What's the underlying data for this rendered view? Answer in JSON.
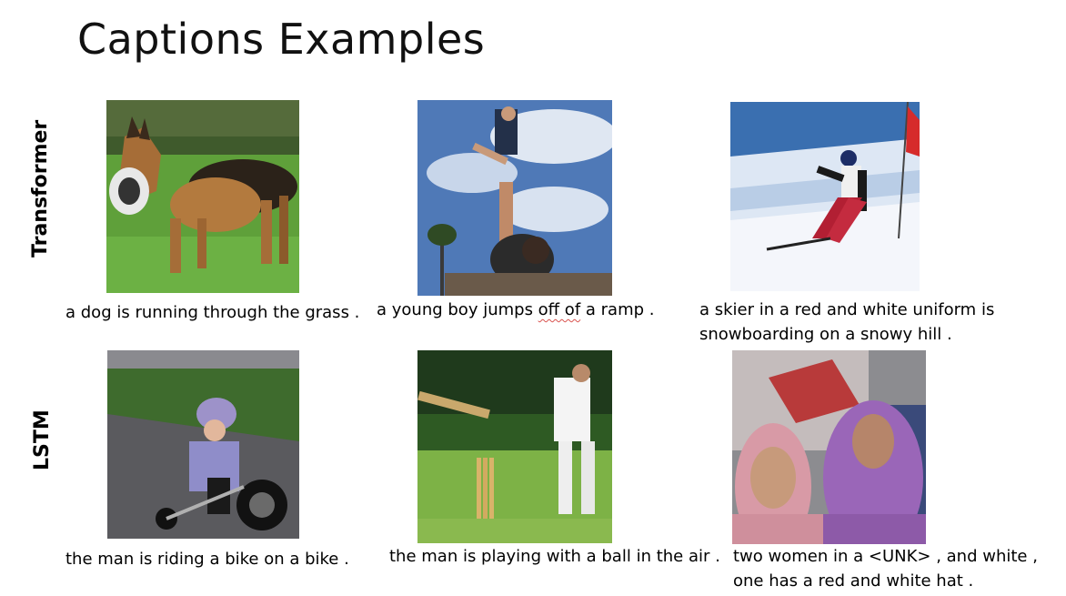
{
  "slide": {
    "title": "Captions Examples"
  },
  "rows": {
    "transformer_label": "Transformer",
    "lstm_label": "LSTM"
  },
  "captions": {
    "t1": "a dog is running through the grass .",
    "t2_pre": "a young boy jumps ",
    "t2_mark": "off of",
    "t2_post": " a ramp .",
    "t3_line1": "a skier in a red and white uniform is",
    "t3_line2": "snowboarding on a snowy hill .",
    "l1": "the man is riding a bike on a bike .",
    "l2": "the man is playing with a ball in the air .",
    "l3_line1": "two women in a <UNK> , and white ,",
    "l3_line2": "one has a red and white hat ."
  },
  "images": [
    {
      "id": "dog-photo",
      "subject": "german shepherd running on grass"
    },
    {
      "id": "boy-thrown-photo",
      "subject": "boy tossed into the air"
    },
    {
      "id": "skier-photo",
      "subject": "skier on snowy slope"
    },
    {
      "id": "child-tricycle-photo",
      "subject": "child on a tricycle"
    },
    {
      "id": "cricket-photo",
      "subject": "cricket batsman and keeper"
    },
    {
      "id": "women-hijab-photo",
      "subject": "two women in headscarves"
    }
  ]
}
